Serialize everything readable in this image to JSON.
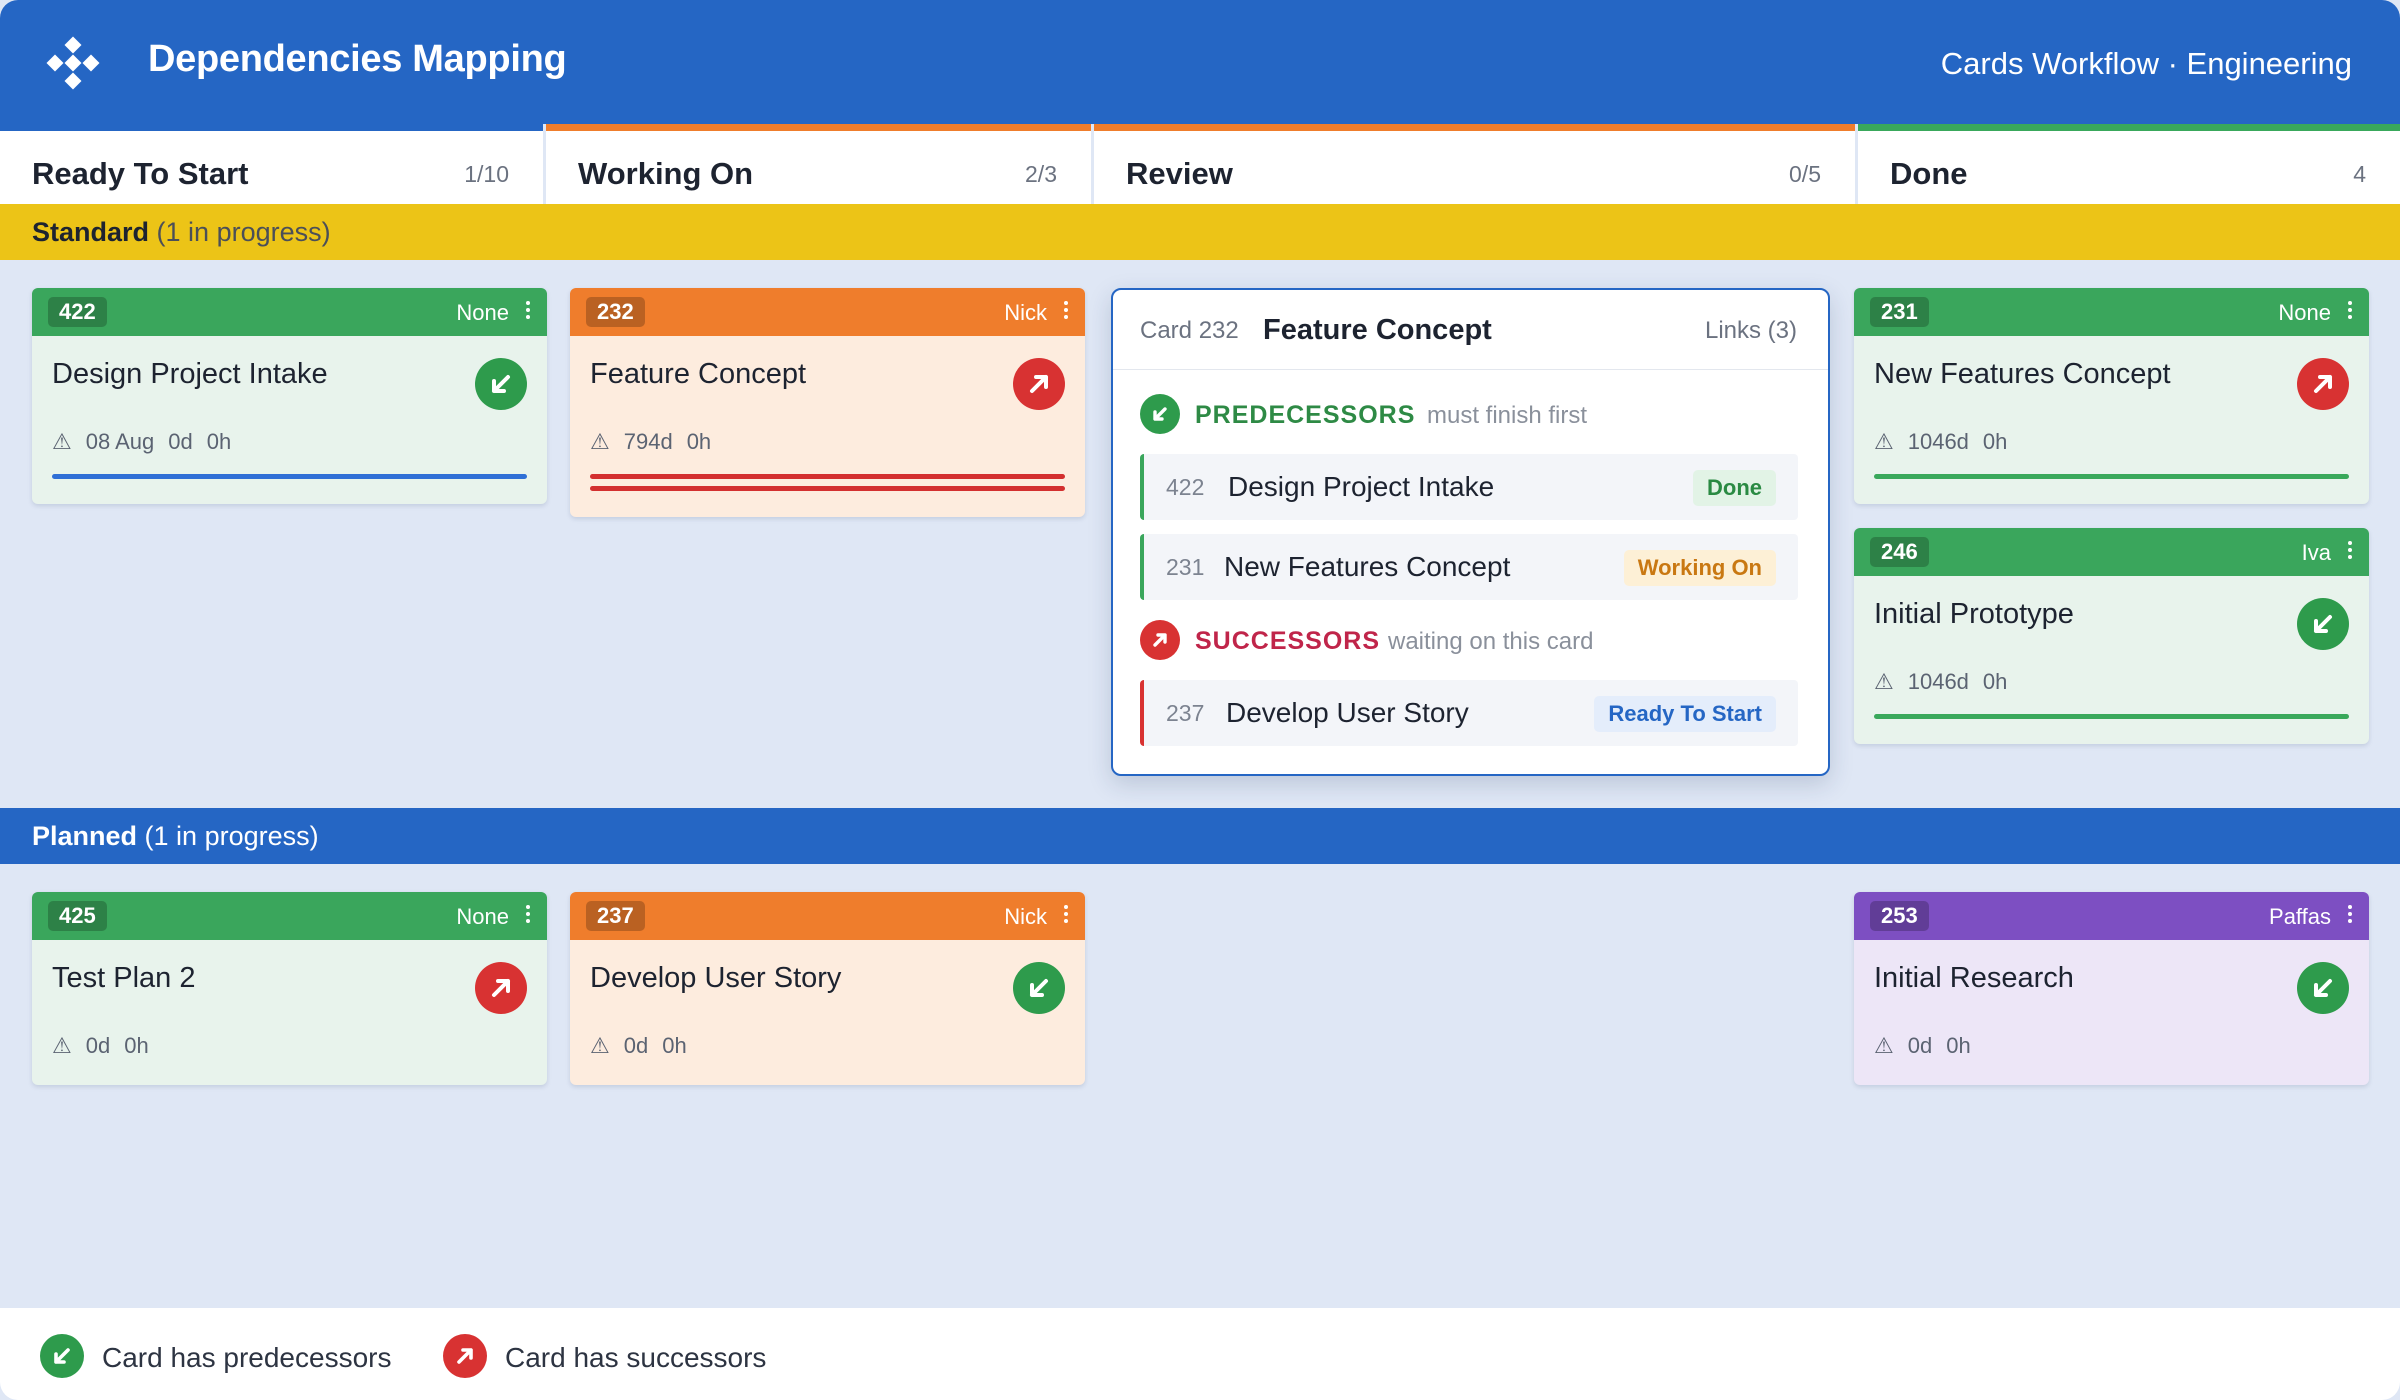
{
  "header": {
    "title": "Dependencies Mapping",
    "subtitle": "Cards Workflow · Engineering",
    "logo_icon": "diamond-grid-logo"
  },
  "columns": [
    {
      "name": "Ready To Start",
      "count": "1/10",
      "color": "#2566c4"
    },
    {
      "name": "Working On",
      "count": "2/3",
      "color": "#ef7d2c"
    },
    {
      "name": "Review",
      "count": "0/5",
      "color": "#ef7d2c"
    },
    {
      "name": "Done",
      "count": "4",
      "color": "#39a85b"
    }
  ],
  "lanes": [
    {
      "name": "Standard",
      "note": "(1 in progress)",
      "color": "#ecc417",
      "text_color": "#1d2330",
      "note_color": "#4b4f58"
    },
    {
      "name": "Planned",
      "note": "(1 in progress)",
      "color": "#2566c4",
      "text_color": "#ffffff",
      "note_color": "#ffffff"
    }
  ],
  "cards": {
    "c422": {
      "id": "422",
      "owner": "None",
      "title": "Design Project Intake",
      "meta": [
        "08 Aug",
        "0d",
        "0h"
      ],
      "dependency": "predecessors",
      "bar_color": "#2f6fd6"
    },
    "c232": {
      "id": "232",
      "owner": "Nick",
      "title": "Feature Concept",
      "meta": [
        "794d",
        "0h"
      ],
      "dependency": "successors",
      "bar_color": "#d32f2f"
    },
    "c231": {
      "id": "231",
      "owner": "None",
      "title": "New Features Concept",
      "meta": [
        "1046d",
        "0h"
      ],
      "dependency": "successors",
      "bar_color": "#39a85b"
    },
    "c246": {
      "id": "246",
      "owner": "Iva",
      "title": "Initial Prototype",
      "meta": [
        "1046d",
        "0h"
      ],
      "dependency": "predecessors",
      "bar_color": "#39a85b"
    },
    "c425": {
      "id": "425",
      "owner": "None",
      "title": "Test Plan 2",
      "meta": [
        "0d",
        "0h"
      ],
      "dependency": "successors"
    },
    "c237": {
      "id": "237",
      "owner": "Nick",
      "title": "Develop User Story",
      "meta": [
        "0d",
        "0h"
      ],
      "dependency": "predecessors"
    },
    "c253": {
      "id": "253",
      "owner": "Paffas",
      "title": "Initial Research",
      "meta": [
        "0d",
        "0h"
      ],
      "dependency": "predecessors"
    }
  },
  "popover": {
    "card_label": "Card 232",
    "title": "Feature Concept",
    "links_label": "Links (3)",
    "predecessors": {
      "title": "PREDECESSORS",
      "note": "must finish first",
      "items": [
        {
          "id": "422",
          "name": "Design Project Intake",
          "status": "Done"
        },
        {
          "id": "231",
          "name": "New Features Concept",
          "status": "Working On"
        }
      ]
    },
    "successors": {
      "title": "SUCCESSORS",
      "note": "waiting on this card",
      "items": [
        {
          "id": "237",
          "name": "Develop User Story",
          "status": "Ready To Start"
        }
      ]
    }
  },
  "legend": {
    "predecessors_label": "Card has predecessors",
    "successors_label": "Card has successors"
  },
  "colors": {
    "green": "#3aa65c",
    "orange": "#ef7d2c",
    "purple": "#7d4fc2",
    "pred_icon": "#2e9b4c",
    "succ_icon": "#d83232",
    "green_card_bg": "#e8f3ec",
    "orange_card_bg": "#fdecde",
    "purple_card_bg": "#ede6f7"
  }
}
